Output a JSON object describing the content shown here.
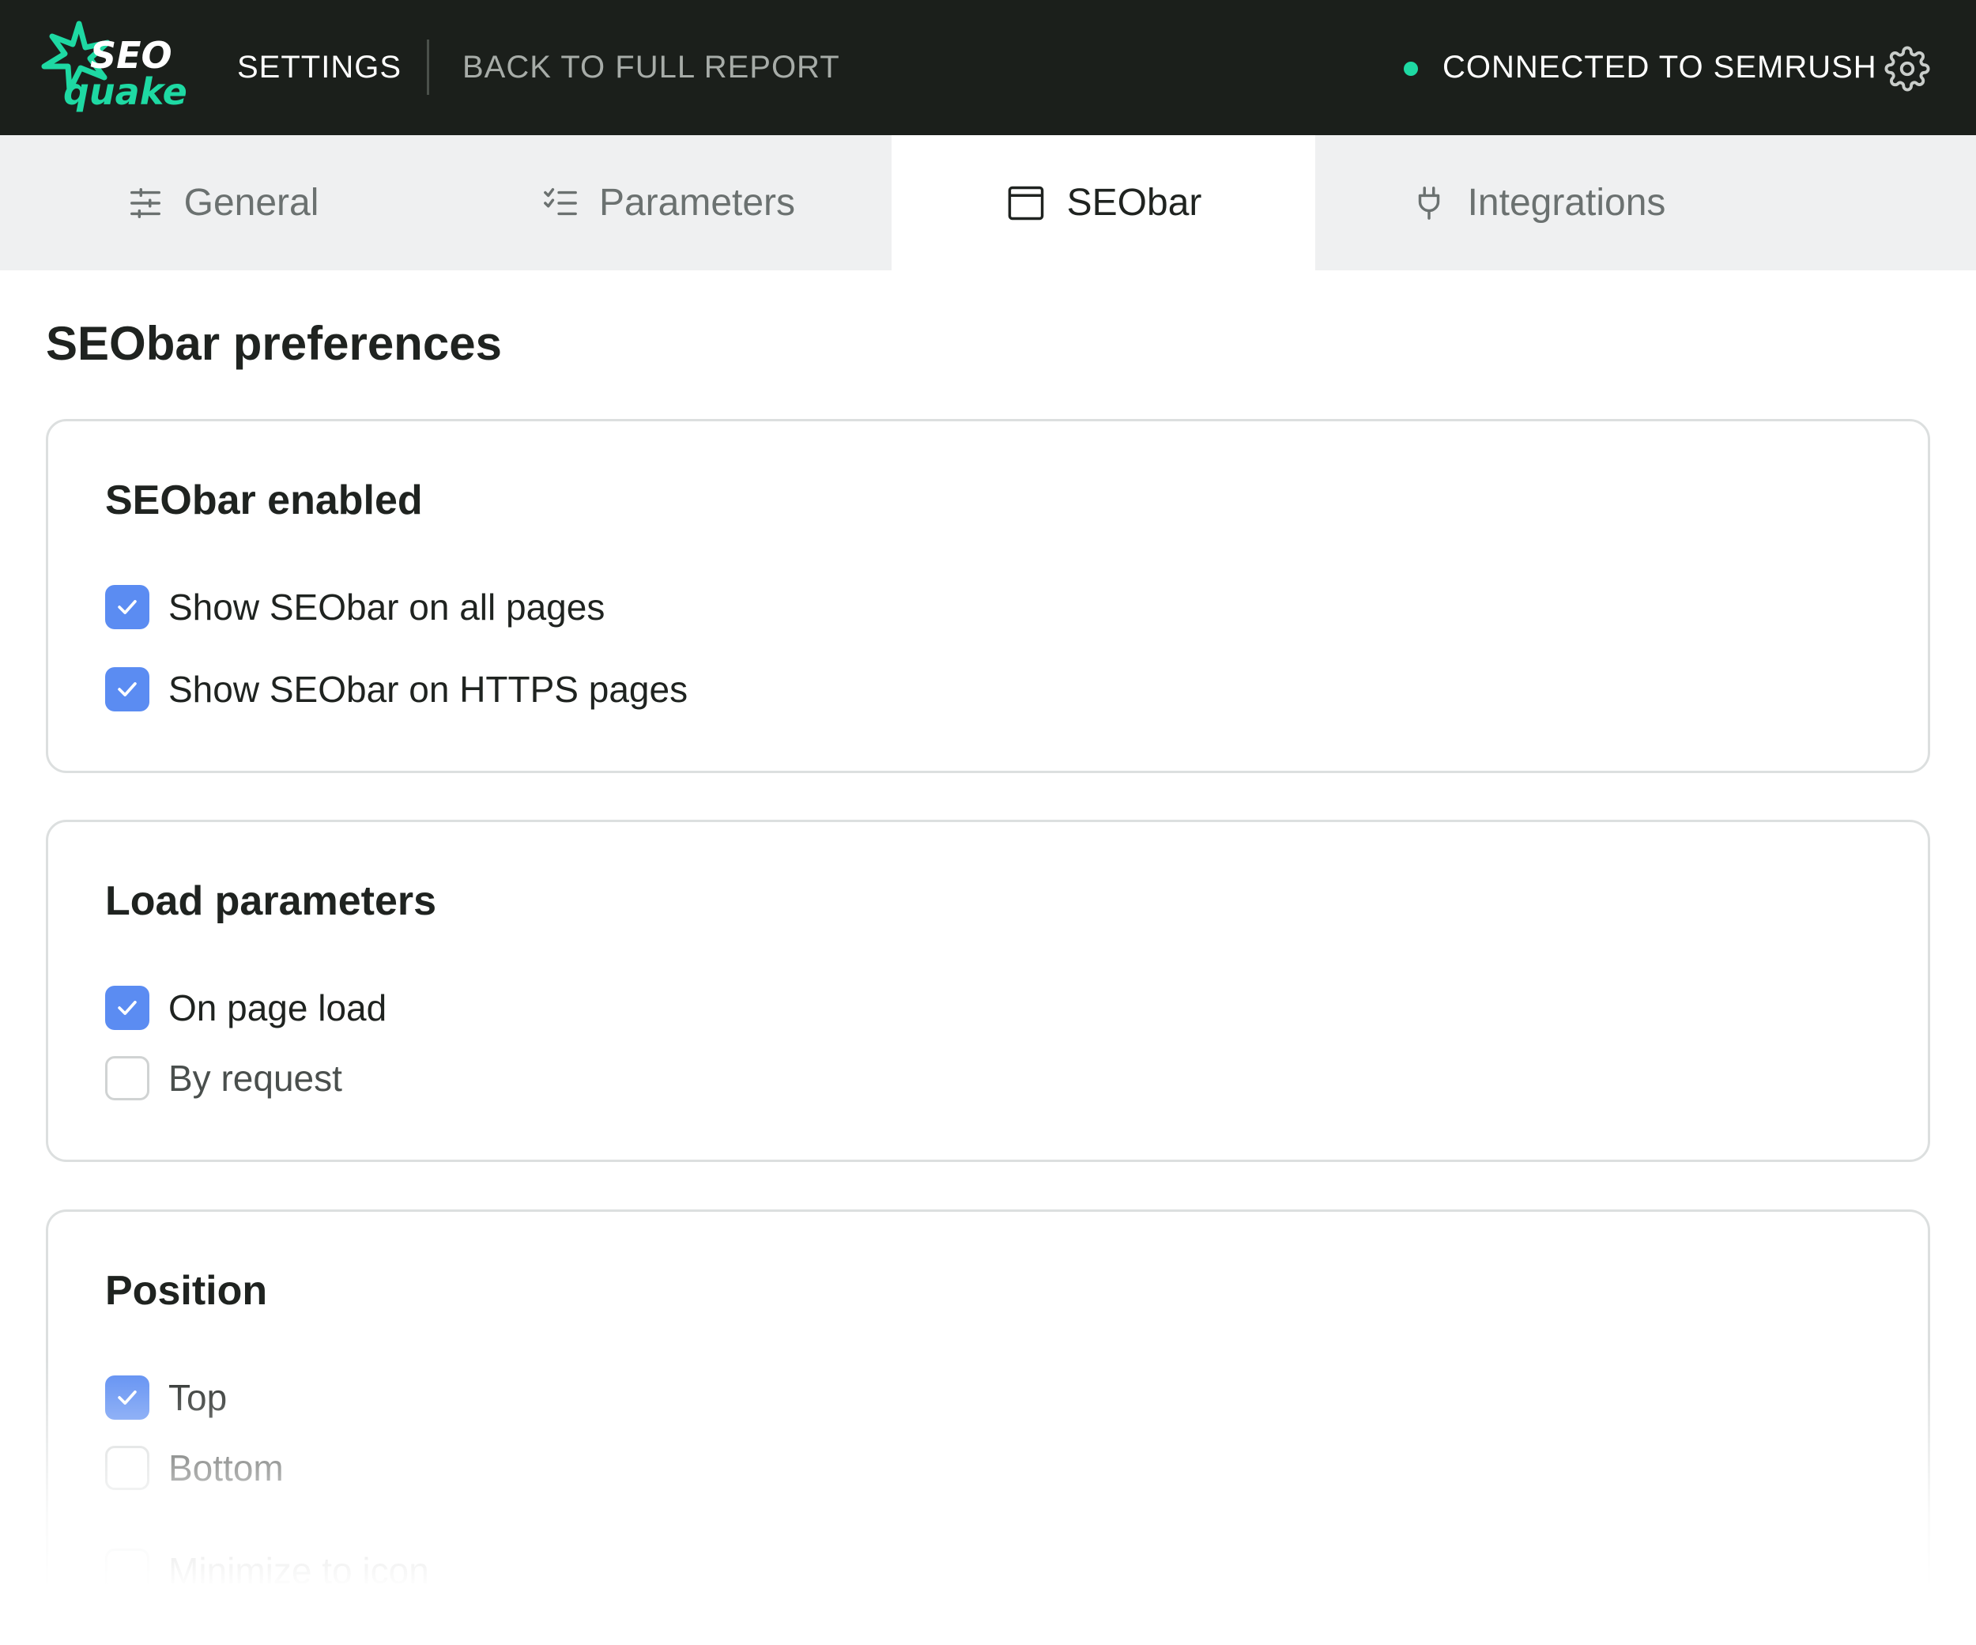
{
  "header": {
    "logo_top": "SEO",
    "logo_bottom": "quake",
    "settings_label": "SETTINGS",
    "back_label": "BACK TO FULL REPORT",
    "status_label": "CONNECTED TO SEMRUSH",
    "status_color": "#1ed9a3",
    "settings_icon": "gear-icon"
  },
  "tabs": [
    {
      "label": "General",
      "icon": "sliders-icon",
      "active": false
    },
    {
      "label": "Parameters",
      "icon": "checklist-icon",
      "active": false
    },
    {
      "label": "SEObar",
      "icon": "window-icon",
      "active": true
    },
    {
      "label": "Integrations",
      "icon": "plug-icon",
      "active": false
    }
  ],
  "page": {
    "title": "SEObar preferences"
  },
  "sections": {
    "enabled": {
      "title": "SEObar enabled",
      "options": [
        {
          "label": "Show SEObar on all pages",
          "checked": true
        },
        {
          "label": "Show SEObar on HTTPS pages",
          "checked": true
        }
      ]
    },
    "load": {
      "title": "Load parameters",
      "options": [
        {
          "label": "On page load",
          "checked": true
        },
        {
          "label": "By request",
          "checked": false
        }
      ]
    },
    "position": {
      "title": "Position",
      "options": [
        {
          "label": "Top",
          "checked": true
        },
        {
          "label": "Bottom",
          "checked": false
        },
        {
          "label": "Minimize to icon",
          "checked": false
        }
      ]
    }
  },
  "colors": {
    "header_bg": "#1b1f1b",
    "checkbox_checked": "#5b8cf2",
    "tab_bg": "#eff0f1"
  }
}
